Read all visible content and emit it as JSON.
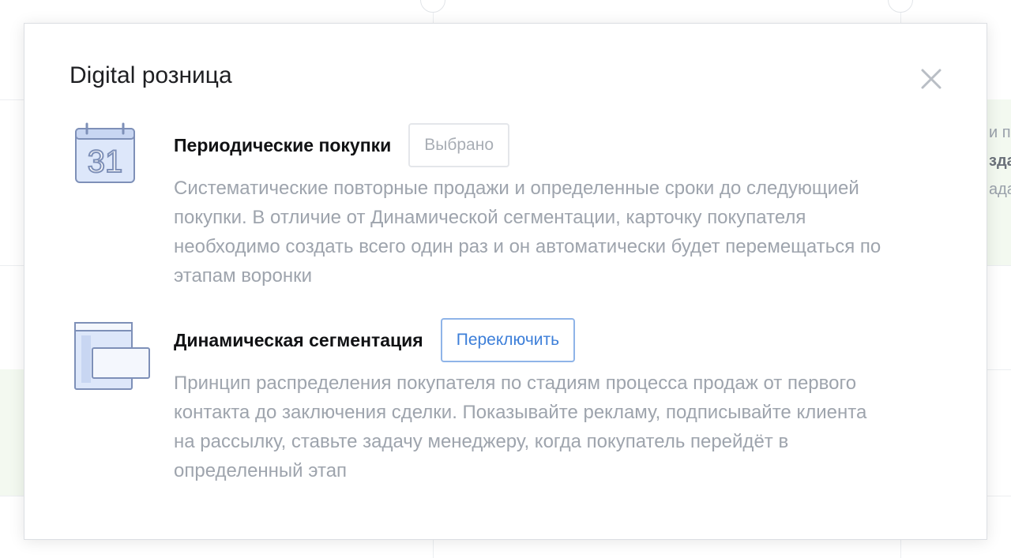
{
  "modal": {
    "title": "Digital розница",
    "close_icon": "close-icon"
  },
  "options": [
    {
      "icon": "calendar-icon",
      "icon_number": "31",
      "name": "Периодические покупки",
      "button_label": "Выбрано",
      "button_state": "selected",
      "description": "Систематические повторные продажи и определенные сроки до следующией покупки. В отличие от Динамической сегментации, карточку покупателя необходимо создать всего один раз и он автоматически будет перемещаться по этапам воронки"
    },
    {
      "icon": "segmentation-windows-icon",
      "name": "Динамическая сегментация",
      "button_label": "Переключить",
      "button_state": "action",
      "description": "Принцип распределения покупателя по стадиям процесса продаж от первого контакта до заключения сделки. Показывайте рекламу, подписывайте клиента на рассылку, ставьте задачу менеджеру, когда покупатель перейдёт в определенный этап"
    }
  ],
  "background": {
    "peek_lines": [
      "и п",
      "зда",
      "адач"
    ]
  },
  "colors": {
    "accent": "#3d7fd9",
    "accent_border": "#8fb4e8",
    "muted_text": "#9ea4ad",
    "title_text": "#1e1f22",
    "icon_stroke": "#7e90b8",
    "icon_fill": "#dde7fa"
  }
}
